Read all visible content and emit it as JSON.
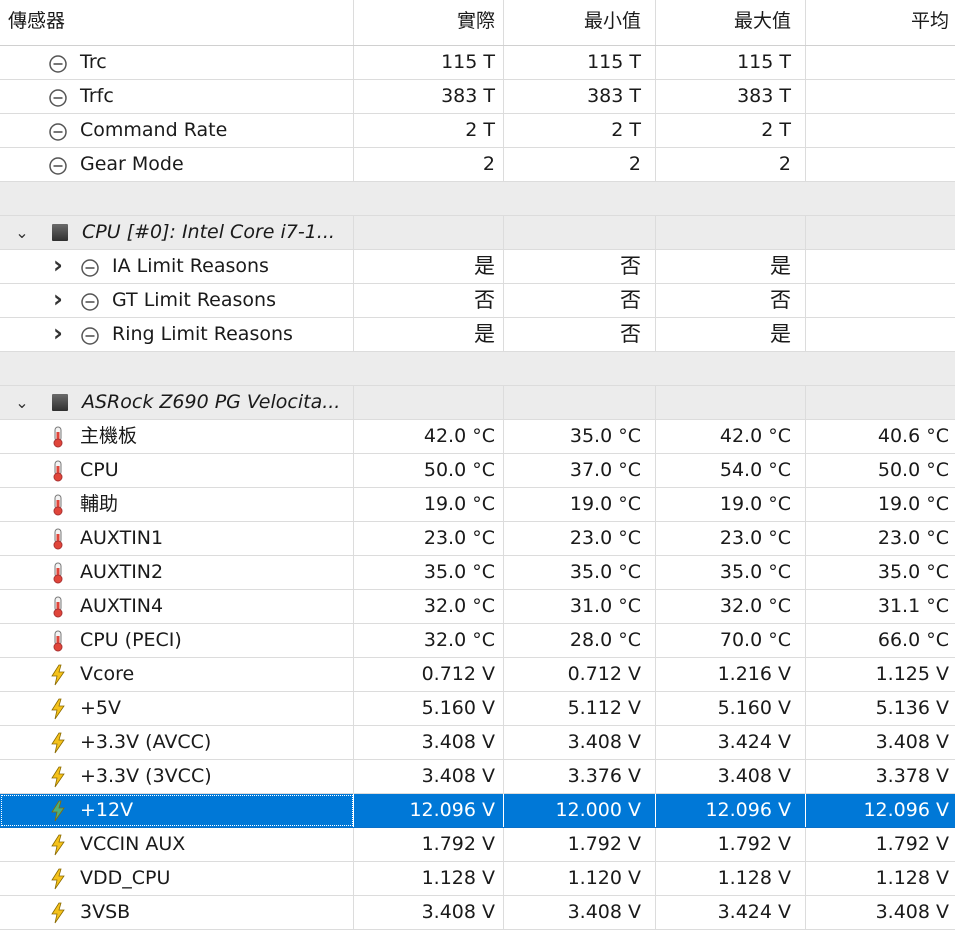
{
  "header": {
    "sensor": "傳感器",
    "current": "實際",
    "min": "最小值",
    "max": "最大值",
    "avg": "平均"
  },
  "rows": [
    {
      "type": "clock",
      "indent": 48,
      "label": "Trc",
      "current": "115 T",
      "min": "115 T",
      "max": "115 T",
      "avg": ""
    },
    {
      "type": "clock",
      "indent": 48,
      "label": "Trfc",
      "current": "383 T",
      "min": "383 T",
      "max": "383 T",
      "avg": ""
    },
    {
      "type": "clock",
      "indent": 48,
      "label": "Command Rate",
      "current": "2 T",
      "min": "2 T",
      "max": "2 T",
      "avg": ""
    },
    {
      "type": "clock",
      "indent": 48,
      "label": "Gear Mode",
      "current": "2",
      "min": "2",
      "max": "2",
      "avg": ""
    },
    {
      "type": "spacer"
    },
    {
      "type": "group",
      "label": "CPU [#0]: Intel Core i7-1...",
      "expander": "collapse"
    },
    {
      "type": "clock",
      "indent": 80,
      "expander": "expand",
      "label": "IA Limit Reasons",
      "current": "是",
      "min": "否",
      "max": "是",
      "avg": ""
    },
    {
      "type": "clock",
      "indent": 80,
      "expander": "expand",
      "label": "GT Limit Reasons",
      "current": "否",
      "min": "否",
      "max": "否",
      "avg": ""
    },
    {
      "type": "clock",
      "indent": 80,
      "expander": "expand",
      "label": "Ring Limit Reasons",
      "current": "是",
      "min": "否",
      "max": "是",
      "avg": ""
    },
    {
      "type": "spacer"
    },
    {
      "type": "group",
      "label": "ASRock Z690 PG Velocita...",
      "expander": "collapse"
    },
    {
      "type": "temp",
      "indent": 48,
      "label": "主機板",
      "current": "42.0 °C",
      "min": "35.0 °C",
      "max": "42.0 °C",
      "avg": "40.6 °C"
    },
    {
      "type": "temp",
      "indent": 48,
      "label": "CPU",
      "current": "50.0 °C",
      "min": "37.0 °C",
      "max": "54.0 °C",
      "avg": "50.0 °C"
    },
    {
      "type": "temp",
      "indent": 48,
      "label": "輔助",
      "current": "19.0 °C",
      "min": "19.0 °C",
      "max": "19.0 °C",
      "avg": "19.0 °C"
    },
    {
      "type": "temp",
      "indent": 48,
      "label": "AUXTIN1",
      "current": "23.0 °C",
      "min": "23.0 °C",
      "max": "23.0 °C",
      "avg": "23.0 °C"
    },
    {
      "type": "temp",
      "indent": 48,
      "label": "AUXTIN2",
      "current": "35.0 °C",
      "min": "35.0 °C",
      "max": "35.0 °C",
      "avg": "35.0 °C"
    },
    {
      "type": "temp",
      "indent": 48,
      "label": "AUXTIN4",
      "current": "32.0 °C",
      "min": "31.0 °C",
      "max": "32.0 °C",
      "avg": "31.1 °C"
    },
    {
      "type": "temp",
      "indent": 48,
      "label": "CPU (PECI)",
      "current": "32.0 °C",
      "min": "28.0 °C",
      "max": "70.0 °C",
      "avg": "66.0 °C"
    },
    {
      "type": "volt",
      "indent": 48,
      "label": "Vcore",
      "current": "0.712 V",
      "min": "0.712 V",
      "max": "1.216 V",
      "avg": "1.125 V"
    },
    {
      "type": "volt",
      "indent": 48,
      "label": "+5V",
      "current": "5.160 V",
      "min": "5.112 V",
      "max": "5.160 V",
      "avg": "5.136 V"
    },
    {
      "type": "volt",
      "indent": 48,
      "label": "+3.3V (AVCC)",
      "current": "3.408 V",
      "min": "3.408 V",
      "max": "3.424 V",
      "avg": "3.408 V"
    },
    {
      "type": "volt",
      "indent": 48,
      "label": "+3.3V (3VCC)",
      "current": "3.408 V",
      "min": "3.376 V",
      "max": "3.408 V",
      "avg": "3.378 V"
    },
    {
      "type": "volt",
      "indent": 48,
      "selected": true,
      "label": "+12V",
      "current": "12.096 V",
      "min": "12.000 V",
      "max": "12.096 V",
      "avg": "12.096 V"
    },
    {
      "type": "volt",
      "indent": 48,
      "label": "VCCIN AUX",
      "current": "1.792 V",
      "min": "1.792 V",
      "max": "1.792 V",
      "avg": "1.792 V"
    },
    {
      "type": "volt",
      "indent": 48,
      "label": "VDD_CPU",
      "current": "1.128 V",
      "min": "1.120 V",
      "max": "1.128 V",
      "avg": "1.128 V"
    },
    {
      "type": "volt",
      "indent": 48,
      "label": "3VSB",
      "current": "3.408 V",
      "min": "3.408 V",
      "max": "3.424 V",
      "avg": "3.408 V"
    }
  ],
  "icons": {
    "clock": "clock-icon",
    "temp": "thermometer-icon",
    "volt": "voltage-icon",
    "group": "chip-icon"
  },
  "colors": {
    "selection": "#0078d7",
    "group_bg": "#ececec",
    "temp_red": "#e0453a",
    "volt_yellow": "#f5c21b",
    "volt_selected": "#4caf7a"
  }
}
